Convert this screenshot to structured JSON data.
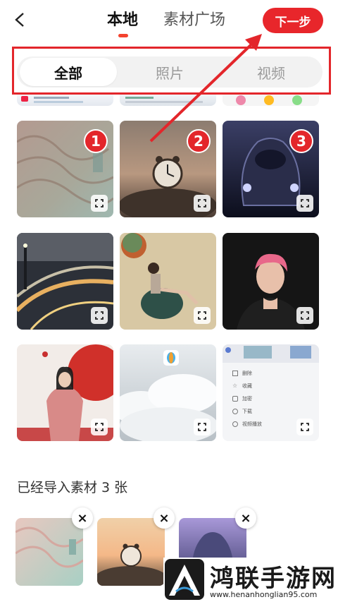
{
  "header": {
    "tabs": [
      {
        "label": "本地",
        "active": true
      },
      {
        "label": "素材广场",
        "active": false
      }
    ],
    "next_label": "下一步",
    "accent_color": "#e8262b"
  },
  "filter": {
    "items": [
      {
        "label": "全部",
        "active": true
      },
      {
        "label": "照片",
        "active": false
      },
      {
        "label": "视频",
        "active": false
      }
    ]
  },
  "grid": {
    "selected_badges": [
      "1",
      "2",
      "3"
    ]
  },
  "menu_preview": {
    "items": [
      "删除",
      "收藏",
      "加密",
      "下载",
      "视频播放"
    ]
  },
  "imported": {
    "title": "已经导入素材 3 张",
    "close_glyph": "×"
  },
  "watermark": {
    "title": "鸿联手游网",
    "url": "www.henanhonglian95.com"
  },
  "icons": {
    "back": "chevron-left-icon",
    "crop": "crop-icon",
    "close": "close-icon"
  }
}
